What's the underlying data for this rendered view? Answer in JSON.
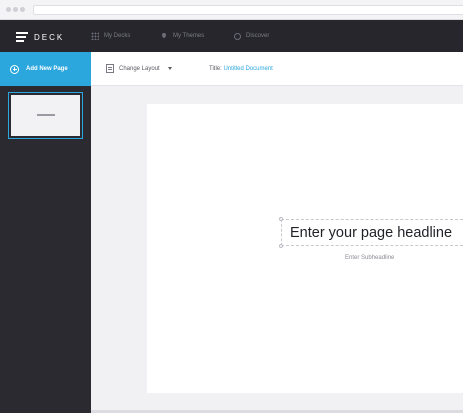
{
  "app": {
    "logo_text": "DECK"
  },
  "nav": {
    "items": [
      {
        "label": "My Decks",
        "icon": "grid-icon"
      },
      {
        "label": "My Themes",
        "icon": "drop-icon"
      },
      {
        "label": "Discover",
        "icon": "bubble-icon"
      }
    ]
  },
  "sidebar": {
    "add_page_label": "Add New Page"
  },
  "toolbar": {
    "change_layout_label": "Change Layout",
    "title_prefix": "Title:",
    "title_value": "Untitled Document"
  },
  "canvas": {
    "headline_placeholder": "Enter your page headline",
    "subheadline_placeholder": "Enter Subheadline"
  },
  "colors": {
    "accent": "#2ba7de",
    "nav_bg": "#26262c",
    "sidebar_bg": "#2a2a30"
  }
}
